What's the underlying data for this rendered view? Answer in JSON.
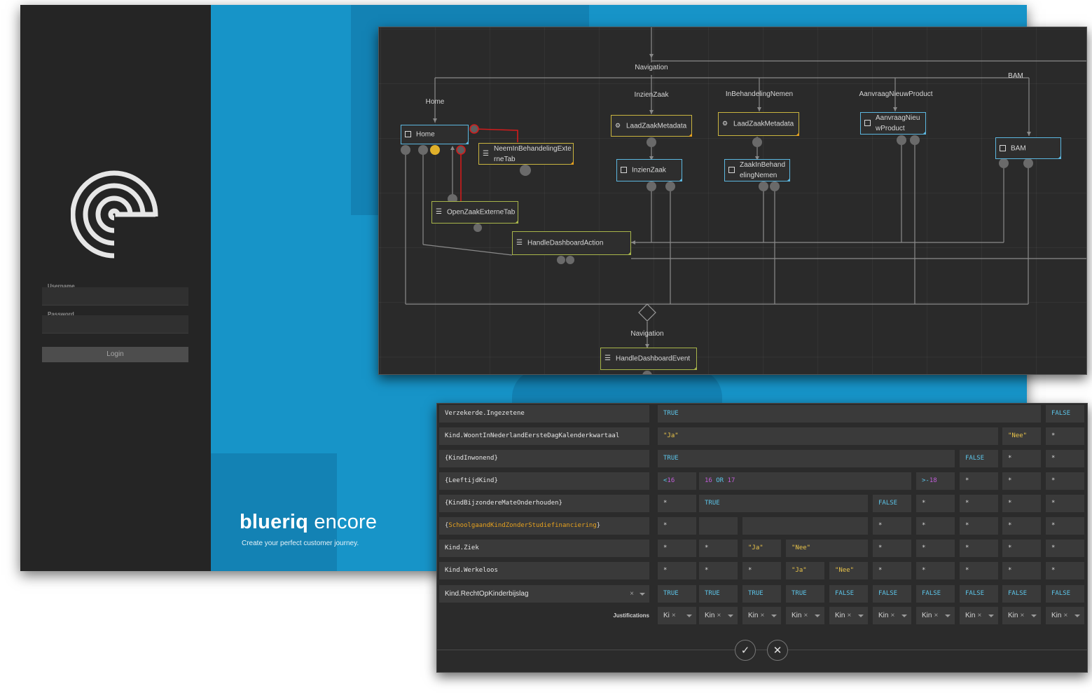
{
  "login": {
    "username_label": "Username",
    "password_label": "Password",
    "username_value": "",
    "password_value": "",
    "login_button": "Login",
    "logo_icon": "blueriq-spiral-logo-icon"
  },
  "brand": {
    "name_part1": "blueriq",
    "name_part2": " encore",
    "tagline": "Create your perfect customer journey."
  },
  "colors": {
    "login_panel": "#252525",
    "hero": "#1794c8",
    "flow_bg": "#2a2a2a",
    "node_blue": "#5cb7e0",
    "node_yellow": "#c9b43f",
    "node_green": "#a8b54a",
    "error_red": "#e01b1b",
    "bool_blue": "#5cc4e8",
    "string_yellow": "#e8c34a",
    "number_purple": "#c15ed8"
  },
  "flow": {
    "labels": {
      "navigation_top": "Navigation",
      "home": "Home",
      "inzien_zaak": "InzienZaak",
      "in_behandeling_nemen": "InBehandelingNemen",
      "aanvraag_nieuw_product": "AanvraagNieuwProduct",
      "bam": "BAM",
      "navigation_bottom": "Navigation"
    },
    "nodes": {
      "home": "Home",
      "neem_in_behandeling": "NeemInBehandelingExterneTab",
      "open_zaak": "OpenZaakExterneTab",
      "handle_dashboard_action": "HandleDashboardAction",
      "laad_zaak_metadata_1": "LaadZaakMetadata",
      "inzien_zaak": "InzienZaak",
      "laad_zaak_metadata_2": "LaadZaakMetadata",
      "zaak_in_behandeling": "ZaakInBehandelingNemen",
      "aanvraag_nieuw_product": "AanvraagNieuwProduct",
      "bam": "BAM",
      "handle_dashboard_event": "HandleDashboardEvent"
    }
  },
  "decision_table": {
    "rows": [
      {
        "condition": "Verzekerde.Ingezetene",
        "cells": [
          "TRUE",
          "FALSE"
        ]
      },
      {
        "condition": "Kind.WoontInNederlandEersteDagKalenderkwartaal",
        "cells": [
          "\"Ja\"",
          "\"Nee\"",
          "*"
        ]
      },
      {
        "condition": "{KindInwonend}",
        "cells": [
          "TRUE",
          "FALSE",
          "*",
          "*"
        ]
      },
      {
        "condition": "{LeeftijdKind}",
        "cells": [
          "<16",
          "16 OR 17",
          ">-18",
          "*",
          "*",
          "*"
        ]
      },
      {
        "condition": "{KindBijzondereMateOnderhouden}",
        "cells": [
          "*",
          "TRUE",
          "FALSE",
          "*",
          "*",
          "*",
          "*"
        ]
      },
      {
        "condition": "{SchoolgaandKindZonderStudiefinanciering}",
        "cells": [
          "*",
          "",
          "",
          "*",
          "*",
          "*",
          "*",
          "*"
        ]
      },
      {
        "condition": "Kind.Ziek",
        "cells": [
          "*",
          "*",
          "\"Ja\"",
          "\"Nee\"",
          "*",
          "*",
          "*",
          "*",
          "*"
        ]
      },
      {
        "condition": "Kind.Werkeloos",
        "cells": [
          "*",
          "*",
          "*",
          "\"Ja\"",
          "\"Nee\"",
          "*",
          "*",
          "*",
          "*",
          "*"
        ]
      }
    ],
    "conclusion": {
      "attribute": "Kind.RechtOpKinderbijslag",
      "clear_icon": "close-icon",
      "values": [
        "TRUE",
        "TRUE",
        "TRUE",
        "TRUE",
        "FALSE",
        "FALSE",
        "FALSE",
        "FALSE",
        "FALSE",
        "FALSE"
      ]
    },
    "justifications": {
      "label": "Justifications",
      "values": [
        "Ki",
        "Kin",
        "Kin",
        "Kin",
        "Kin",
        "Kin",
        "Kin",
        "Kin",
        "Kin",
        "Kin"
      ],
      "clear_glyph": "×"
    },
    "confirm_icon": "✓",
    "cancel_icon": "✕"
  }
}
